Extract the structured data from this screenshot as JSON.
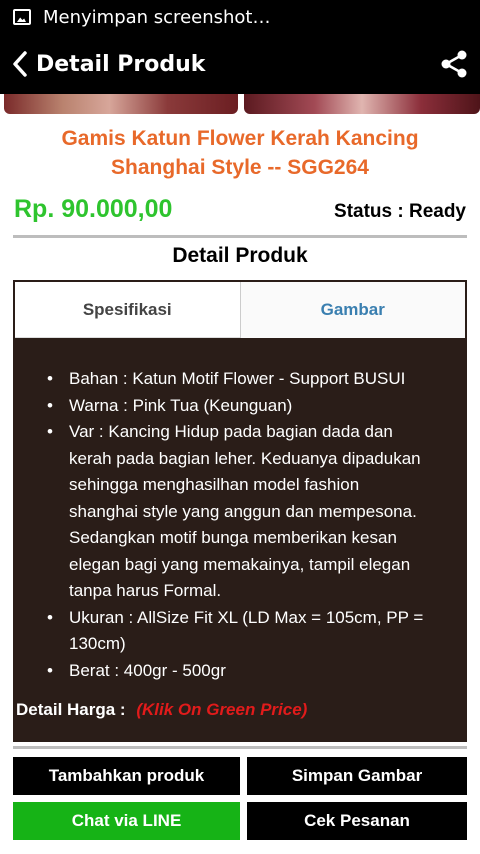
{
  "statusbar": {
    "icon": "screenshot-icon",
    "text": "Menyimpan screenshot…"
  },
  "appbar": {
    "title": "Detail Produk",
    "back_icon": "chevron-left-icon",
    "share_icon": "share-icon"
  },
  "product": {
    "title_line1": "Gamis Katun Flower Kerah Kancing",
    "title_line2": "Shanghai Style -- SGG264",
    "price": "Rp. 90.000,00",
    "status": "Status : Ready",
    "title_color": "#e8692a",
    "price_color": "#2ec42e"
  },
  "section": {
    "title": "Detail Produk"
  },
  "tabs": [
    {
      "label": "Spesifikasi"
    },
    {
      "label": "Gambar"
    }
  ],
  "specs": [
    {
      "lines": [
        "Bahan : Katun Motif Flower - Support BUSUI"
      ]
    },
    {
      "lines": [
        "Warna : Pink Tua (Keunguan)"
      ]
    },
    {
      "lines": [
        "Var : Kancing Hidup pada bagian dada dan",
        "kerah pada bagian leher. Keduanya dipadukan",
        "sehingga menghasilhan model fashion",
        "shanghai style yang anggun dan mempesona.",
        "Sedangkan motif bunga memberikan kesan",
        "elegan bagi yang memakainya, tampil elegan",
        "tanpa harus Formal."
      ]
    },
    {
      "lines": [
        "Ukuran : AllSize Fit XL (LD Max = 105cm, PP =",
        "130cm)"
      ]
    },
    {
      "lines": [
        "Berat : 400gr - 500gr"
      ]
    }
  ],
  "harga": {
    "label": "Detail Harga :",
    "link": "(Klik On Green Price)"
  },
  "buttons": {
    "tambahkan": "Tambahkan produk",
    "simpan": "Simpan Gambar",
    "chat": "Chat via LINE",
    "cek": "Cek Pesanan"
  }
}
